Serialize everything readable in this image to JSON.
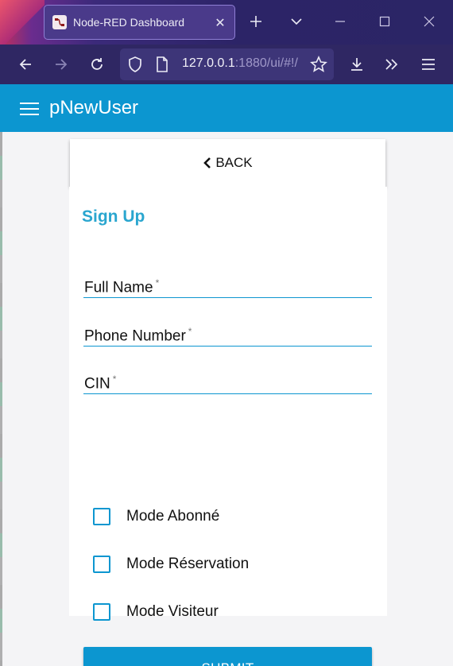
{
  "browser": {
    "tab_title": "Node-RED Dashboard",
    "url_host": "127.0.0.1",
    "url_rest": ":1880/ui/#!/",
    "tab_favicon": "node-red-icon",
    "icons": [
      "new-tab-icon",
      "tab-list-icon",
      "minimize-icon",
      "maximize-icon",
      "close-window-icon",
      "back-icon",
      "forward-icon",
      "reload-icon",
      "shield-icon",
      "page-icon",
      "bookmark-star-icon",
      "download-icon",
      "overflow-icon",
      "menu-icon"
    ]
  },
  "app": {
    "title": "pNewUser",
    "accent": "#0c96d0"
  },
  "back_button": {
    "label": "BACK"
  },
  "form": {
    "title": "Sign Up",
    "fields": [
      {
        "label": "Full Name",
        "required": "*"
      },
      {
        "label": "Phone Number",
        "required": "*"
      },
      {
        "label": "CIN",
        "required": "*"
      }
    ],
    "checkboxes": [
      {
        "label": "Mode Abonné"
      },
      {
        "label": "Mode Réservation"
      },
      {
        "label": "Mode Visiteur"
      }
    ],
    "submit_label": "SUBMIT"
  }
}
